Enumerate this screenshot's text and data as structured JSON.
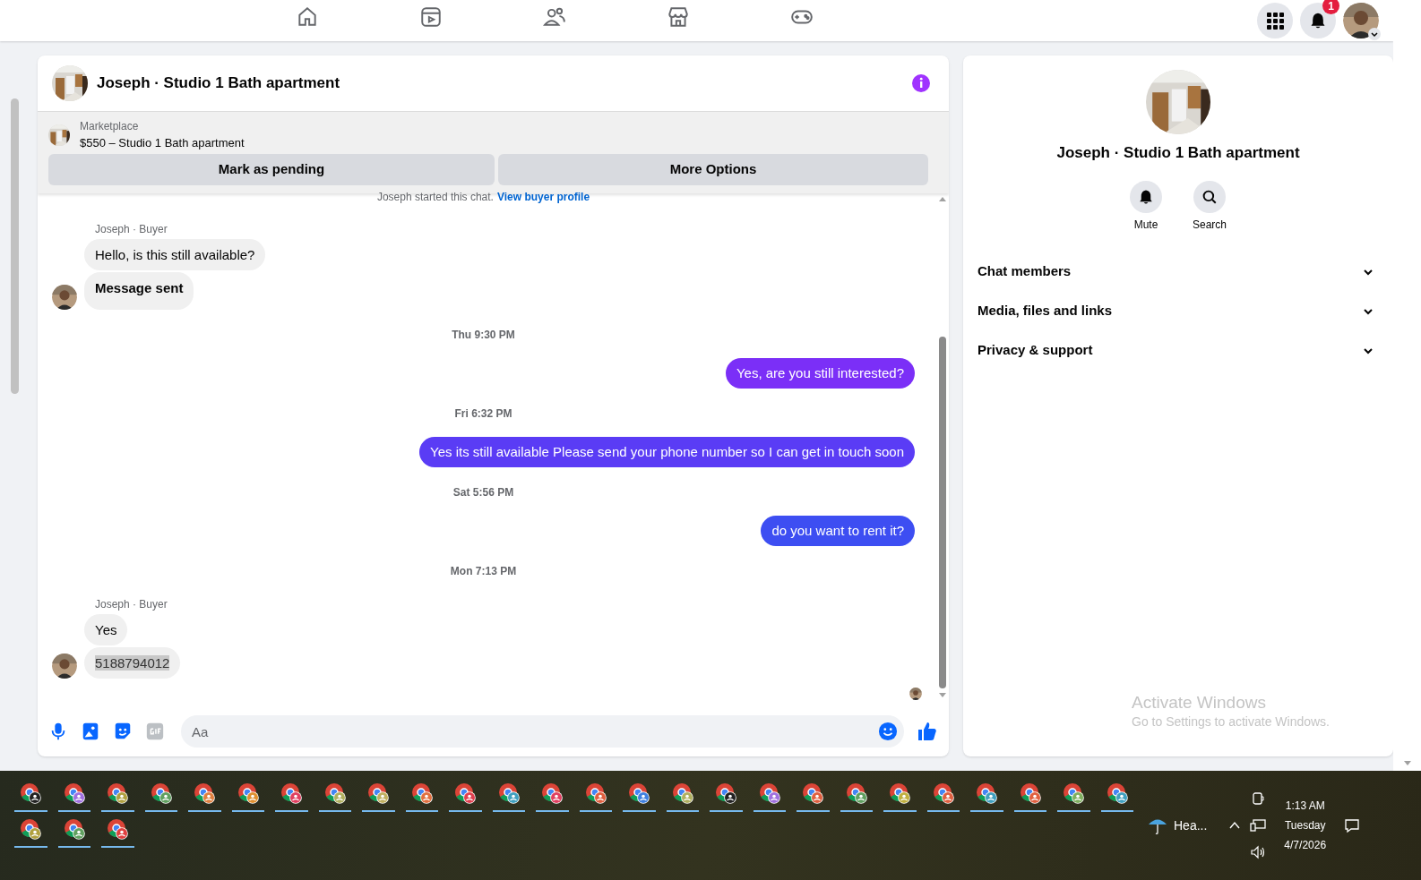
{
  "top_nav": {
    "notification_count": "1"
  },
  "chat": {
    "title": "Joseph · Studio 1 Bath apartment",
    "listing": {
      "label": "Marketplace",
      "title": "$550 – Studio 1 Bath apartment"
    },
    "actions": [
      "Mark as pending",
      "More Options"
    ],
    "intro": {
      "text": "Joseph started this chat.",
      "link": "View buyer profile"
    },
    "messages": [
      {
        "kind": "incoming",
        "sender": "Joseph · Buyer",
        "bubbles": [
          {
            "text": "Hello, is this still available?",
            "bold": false,
            "highlighted": false
          },
          {
            "text": "Message sent",
            "bold": true,
            "highlighted": false
          }
        ]
      },
      {
        "kind": "timestamp",
        "text": "Thu 9:30 PM"
      },
      {
        "kind": "outgoing",
        "text": "Yes, are you still interested?",
        "color": "#7b2ff7"
      },
      {
        "kind": "timestamp",
        "text": "Fri 6:32 PM"
      },
      {
        "kind": "outgoing",
        "text": "Yes its still available Please send your phone number so I can get in touch soon",
        "color": "#5a3cf5"
      },
      {
        "kind": "timestamp",
        "text": "Sat 5:56 PM"
      },
      {
        "kind": "outgoing",
        "text": "do you want to rent it?",
        "color": "#3d4ef2"
      },
      {
        "kind": "timestamp",
        "text": "Mon 7:13 PM"
      },
      {
        "kind": "incoming",
        "sender": "Joseph · Buyer",
        "bubbles": [
          {
            "text": "Yes",
            "bold": false,
            "highlighted": false
          },
          {
            "text": "5188794012",
            "bold": false,
            "highlighted": true
          }
        ]
      }
    ],
    "composer": {
      "placeholder": "Aa"
    }
  },
  "details": {
    "title": "Joseph · Studio 1 Bath apartment",
    "actions": [
      {
        "kind": "mute",
        "label": "Mute"
      },
      {
        "kind": "search",
        "label": "Search"
      }
    ],
    "sections": [
      {
        "label": "Chat members",
        "expanded": false
      },
      {
        "label": "Media, files and links",
        "expanded": false
      },
      {
        "label": "Privacy & support",
        "expanded": false
      }
    ]
  },
  "activation_notice": {
    "title": "Activate Windows",
    "subtitle": "Go to Settings to activate Windows."
  },
  "taskbar": {
    "apps": [
      {
        "color": "#222222"
      },
      {
        "color": "#a070e0"
      },
      {
        "color": "#b0a040"
      },
      {
        "color": "#60a060"
      },
      {
        "color": "#e08040"
      },
      {
        "color": "#e09030"
      },
      {
        "color": "#e04060"
      },
      {
        "color": "#b0b060"
      },
      {
        "color": "#c0b060"
      },
      {
        "color": "#e07040"
      },
      {
        "color": "#e04050"
      },
      {
        "color": "#40a0c0"
      },
      {
        "color": "#e04060"
      },
      {
        "color": "#e06040"
      },
      {
        "color": "#4080e0"
      },
      {
        "color": "#b0b060"
      },
      {
        "color": "#222222"
      },
      {
        "color": "#a070e0"
      },
      {
        "color": "#e06040"
      },
      {
        "color": "#60a060"
      },
      {
        "color": "#c0b040"
      },
      {
        "color": "#e06040"
      },
      {
        "color": "#40a0c0"
      },
      {
        "color": "#e06040"
      },
      {
        "color": "#80b060"
      },
      {
        "color": "#40a0c0"
      },
      {
        "color": "#b0a040"
      },
      {
        "color": "#60a060"
      },
      {
        "color": "#e04040"
      }
    ],
    "weather": "Hea...",
    "time": "1:13 AM",
    "day": "Tuesday",
    "date": "4/7/2026"
  }
}
